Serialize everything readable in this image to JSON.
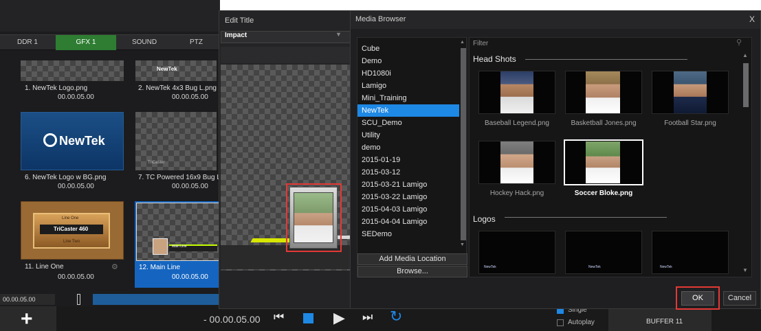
{
  "ddr": {
    "tabs": [
      "DDR 1",
      "GFX 1",
      "SOUND",
      "PTZ"
    ],
    "items": [
      {
        "label": "1. NewTek Logo.png",
        "duration": "00.00.05.00"
      },
      {
        "label": "2. NewTek 4x3 Bug L.png",
        "duration": "00.00.05.00",
        "logo": "NewTek"
      },
      {
        "label": "6. NewTek Logo w BG.png",
        "duration": "00.00.05.00",
        "logo": "NewTek"
      },
      {
        "label": "7. TC Powered 16x9 Bug L",
        "duration": "00.00.05.00",
        "logo": "TriCaster"
      },
      {
        "label": "11. Line One",
        "duration": "00.00.05.00",
        "line1": "Line One",
        "line2": "TriCaster 460",
        "line3": "Line Two"
      },
      {
        "label": "12. Main Line",
        "duration": "00.00.05.00",
        "banner": "Main Line"
      }
    ],
    "timecode": "00.00.05.00",
    "transport_time": "- 00.00.05.00",
    "single_label": "Single",
    "autoplay_label": "Autoplay",
    "buffer_label": "BUFFER 11"
  },
  "edit_title": {
    "title": "Edit Title",
    "template": "Impact"
  },
  "media_browser": {
    "title": "Media Browser",
    "close": "X",
    "folders": [
      "Cube",
      "Demo",
      "HD1080i",
      "Lamigo",
      "Mini_Training",
      "NewTek",
      "SCU_Demo",
      "Utility",
      "demo",
      "2015-01-19",
      "2015-03-12",
      "2015-03-21 Lamigo",
      "2015-03-22 Lamigo",
      "2015-04-03 Lamigo",
      "2015-04-04 Lamigo",
      "SEDemo"
    ],
    "selected_folder": "NewTek",
    "add_location": "Add Media Location",
    "browse": "Browse...",
    "filter_placeholder": "Filter",
    "sections": [
      {
        "title": "Head Shots",
        "items": [
          "Baseball Legend.png",
          "Basketball Jones.png",
          "Football Star.png",
          "Hockey Hack.png",
          "Soccer Bloke.png"
        ]
      },
      {
        "title": "Logos",
        "items": [
          "NewTek",
          "NewTek",
          "NewTek"
        ]
      }
    ],
    "selected_item": "Soccer Bloke.png",
    "ok": "OK",
    "cancel": "Cancel"
  },
  "colors": {
    "accent": "#1e88e5",
    "highlight": "#e53935",
    "active_tab": "#2e7d32"
  }
}
